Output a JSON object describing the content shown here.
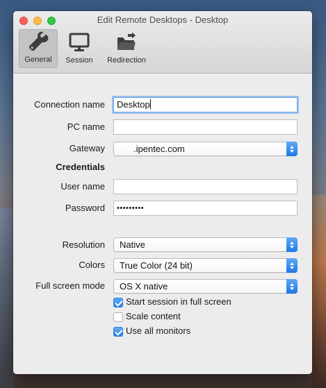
{
  "window": {
    "title": "Edit Remote Desktops - Desktop"
  },
  "toolbar": {
    "tabs": [
      {
        "label": "General",
        "icon": "wrench-icon",
        "active": true
      },
      {
        "label": "Session",
        "icon": "monitor-icon",
        "active": false
      },
      {
        "label": "Redirection",
        "icon": "folder-redirect-icon",
        "active": false
      }
    ]
  },
  "form": {
    "connection_name": {
      "label": "Connection name",
      "value": "Desktop"
    },
    "pc_name": {
      "label": "PC name",
      "value": ""
    },
    "gateway": {
      "label": "Gateway",
      "value": ".ipentec.com"
    },
    "credentials_heading": "Credentials",
    "user_name": {
      "label": "User name",
      "value": ""
    },
    "password": {
      "label": "Password",
      "value": "•••••••••"
    },
    "resolution": {
      "label": "Resolution",
      "value": "Native"
    },
    "colors": {
      "label": "Colors",
      "value": "True Color (24 bit)"
    },
    "full_screen_mode": {
      "label": "Full screen mode",
      "value": "OS X native"
    },
    "checkboxes": [
      {
        "label": "Start session in full screen",
        "checked": true
      },
      {
        "label": "Scale content",
        "checked": false
      },
      {
        "label": "Use all monitors",
        "checked": true
      }
    ]
  },
  "colors": {
    "accent": "#1c79e8",
    "close": "#fc605c",
    "minimize": "#fdbc40",
    "maximize": "#34c84a"
  }
}
